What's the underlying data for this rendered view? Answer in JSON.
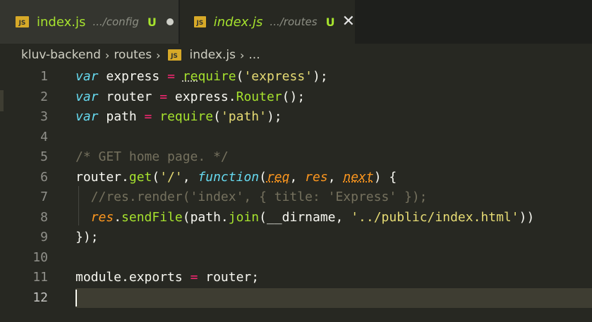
{
  "tabs": [
    {
      "icon": "js-file-icon",
      "badge": "JS",
      "name": "index.js",
      "path": ".../config",
      "status": "U",
      "dirty": true
    },
    {
      "icon": "js-file-icon",
      "badge": "JS",
      "name": "index.js",
      "path": ".../routes",
      "status": "U",
      "close": "✕"
    }
  ],
  "breadcrumb": {
    "project": "kluv-backend",
    "folder": "routes",
    "file": "index.js",
    "more": "...",
    "separator": "›"
  },
  "editor": {
    "line_numbers": [
      "1",
      "2",
      "3",
      "4",
      "5",
      "6",
      "7",
      "8",
      "9",
      "10",
      "11",
      "12"
    ],
    "current_line": 12,
    "lines": [
      [
        {
          "t": "var",
          "c": "kw-i"
        },
        {
          "t": " express ",
          "c": "plain"
        },
        {
          "t": "=",
          "c": "op"
        },
        {
          "t": " ",
          "c": "plain"
        },
        {
          "t": "re",
          "c": "fn dots"
        },
        {
          "t": "quire",
          "c": "fn"
        },
        {
          "t": "(",
          "c": "plain"
        },
        {
          "t": "'express'",
          "c": "str"
        },
        {
          "t": ");",
          "c": "plain"
        }
      ],
      [
        {
          "t": "var",
          "c": "kw-i"
        },
        {
          "t": " router ",
          "c": "plain"
        },
        {
          "t": "=",
          "c": "op"
        },
        {
          "t": " express.",
          "c": "plain"
        },
        {
          "t": "Router",
          "c": "fn"
        },
        {
          "t": "();",
          "c": "plain"
        }
      ],
      [
        {
          "t": "var",
          "c": "kw-i"
        },
        {
          "t": " path ",
          "c": "plain"
        },
        {
          "t": "=",
          "c": "op"
        },
        {
          "t": " ",
          "c": "plain"
        },
        {
          "t": "require",
          "c": "fn"
        },
        {
          "t": "(",
          "c": "plain"
        },
        {
          "t": "'path'",
          "c": "str"
        },
        {
          "t": ");",
          "c": "plain"
        }
      ],
      [],
      [
        {
          "t": "/* GET home page. */",
          "c": "cm"
        }
      ],
      [
        {
          "t": "router.",
          "c": "plain"
        },
        {
          "t": "get",
          "c": "fn"
        },
        {
          "t": "(",
          "c": "plain"
        },
        {
          "t": "'/'",
          "c": "str"
        },
        {
          "t": ", ",
          "c": "plain"
        },
        {
          "t": "function",
          "c": "kw-i"
        },
        {
          "t": "(",
          "c": "plain"
        },
        {
          "t": "req",
          "c": "param-u"
        },
        {
          "t": ", ",
          "c": "plain"
        },
        {
          "t": "res",
          "c": "param"
        },
        {
          "t": ", ",
          "c": "plain"
        },
        {
          "t": "next",
          "c": "param-u"
        },
        {
          "t": ") {",
          "c": "plain"
        }
      ],
      [
        {
          "t": "  //res.render('index', { title: 'Express' });",
          "c": "cm"
        }
      ],
      [
        {
          "t": "  ",
          "c": "plain"
        },
        {
          "t": "res",
          "c": "param"
        },
        {
          "t": ".",
          "c": "plain"
        },
        {
          "t": "sendFile",
          "c": "fn"
        },
        {
          "t": "(path.",
          "c": "plain"
        },
        {
          "t": "join",
          "c": "fn"
        },
        {
          "t": "(__dirname, ",
          "c": "plain"
        },
        {
          "t": "'../public/index.html'",
          "c": "str"
        },
        {
          "t": "))",
          "c": "plain"
        }
      ],
      [
        {
          "t": "});",
          "c": "plain"
        }
      ],
      [],
      [
        {
          "t": "module.exports ",
          "c": "plain"
        },
        {
          "t": "=",
          "c": "op"
        },
        {
          "t": " router;",
          "c": "plain"
        }
      ],
      []
    ]
  },
  "colors": {
    "background": "#272822",
    "tabbar": "#1e1f1c",
    "keyword": "#66d9ef",
    "operator": "#f92672",
    "function": "#a6e22e",
    "string": "#e6db74",
    "comment": "#75715e",
    "parameter": "#fd971f"
  }
}
